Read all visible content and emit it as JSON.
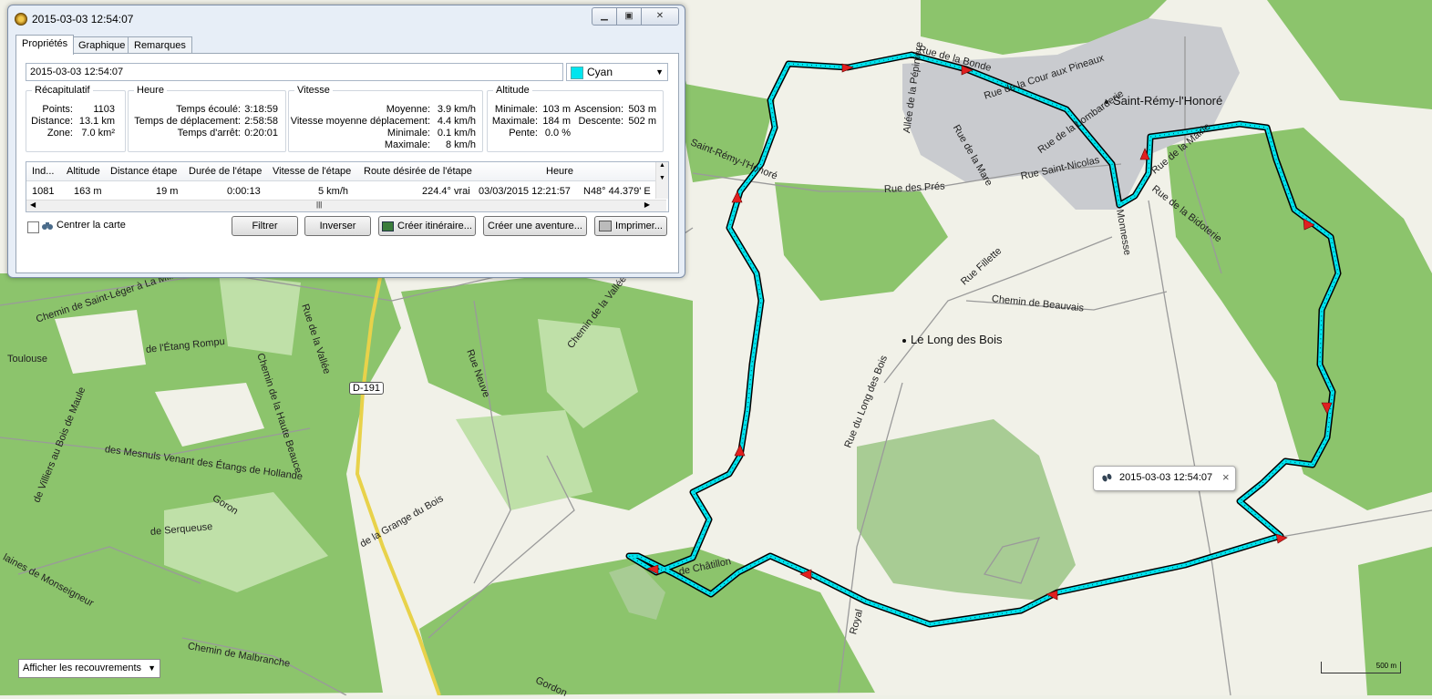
{
  "window": {
    "title": "2015-03-03 12:54:07",
    "tabs": [
      "Propriétés",
      "Graphique",
      "Remarques"
    ],
    "active_tab": 0
  },
  "track": {
    "name": "2015-03-03 12:54:07",
    "color_name": "Cyan",
    "color": "#00e5ef"
  },
  "summary": {
    "legend": "Récapitulatif",
    "points_label": "Points:",
    "points": "1103",
    "distance_label": "Distance:",
    "distance": "13.1 km",
    "zone_label": "Zone:",
    "zone": "7.0 km²"
  },
  "time": {
    "legend": "Heure",
    "elapsed_label": "Temps écoulé:",
    "elapsed": "3:18:59",
    "moving_label": "Temps de déplacement:",
    "moving": "2:58:58",
    "stopped_label": "Temps d'arrêt:",
    "stopped": "0:20:01"
  },
  "speed": {
    "legend": "Vitesse",
    "avg_label": "Moyenne:",
    "avg": "3.9 km/h",
    "moving_avg_label": "Vitesse moyenne déplacement:",
    "moving_avg": "4.4 km/h",
    "min_label": "Minimale:",
    "min": "0.1 km/h",
    "max_label": "Maximale:",
    "max": "8 km/h"
  },
  "altitude": {
    "legend": "Altitude",
    "min_label": "Minimale:",
    "min": "103 m",
    "max_label": "Maximale:",
    "max": "184 m",
    "slope_label": "Pente:",
    "slope": "0.0 %",
    "ascent_label": "Ascension:",
    "ascent": "503 m",
    "descent_label": "Descente:",
    "descent": "502 m"
  },
  "table": {
    "columns": [
      "Ind...",
      "Altitude",
      "Distance étape",
      "Durée de l'étape",
      "Vitesse de l'étape",
      "Route désirée de l'étape",
      "Heure",
      ""
    ],
    "rows": [
      [
        "1081",
        "163 m",
        "19 m",
        "0:00:13",
        "5 km/h",
        "224.4° vrai",
        "03/03/2015 12:21:57",
        "N48° 44.379' E"
      ]
    ]
  },
  "controls": {
    "center_map": "Centrer la carte",
    "filter": "Filtrer",
    "invert": "Inverser",
    "create_route": "Créer itinéraire...",
    "create_adventure": "Créer une aventure...",
    "print": "Imprimer..."
  },
  "popup": {
    "title": "2015-03-03 12:54:07",
    "close": "×"
  },
  "overlay_select": "Afficher les recouvrements",
  "scale_label": "500 m",
  "map_labels": {
    "town1": "Saint-Rémy-l'Honoré",
    "town2": "Le Long des Bois",
    "road_shield": "D-191",
    "streets": [
      "Rue de la Bonde",
      "Allée de la Pépinière",
      "Rue de la Cour aux Pineaux",
      "Rue de la Mare",
      "Rue de la Lombarderie",
      "Rue de la Mairie",
      "Rue Saint-Nicolas",
      "Rue des Prés",
      "Rue de la Bidoterie",
      "Rue Fillette",
      "Chemin de Beauvais",
      "Rue du Long des Bois",
      "Rue Neuve",
      "Chemin de la Vallée",
      "Rue de la Vallée",
      "Chemin de la Haute Beauce",
      "de l'Étang Rompu",
      "Chemin de Saint-Léger à La Millière",
      "Toulouse",
      "de Villiers au Bois de Maule",
      "des Mesnuls Venant des Étangs de Hollande",
      "Goron",
      "de Serqueuse",
      "laines de Monseigneur",
      "de la Grange du Bois",
      "de Châtillon",
      "Royal",
      "Chemin de Malbranche",
      "Gordon",
      "Saint-Rémy-l'Honoré",
      "Monnesse"
    ]
  }
}
